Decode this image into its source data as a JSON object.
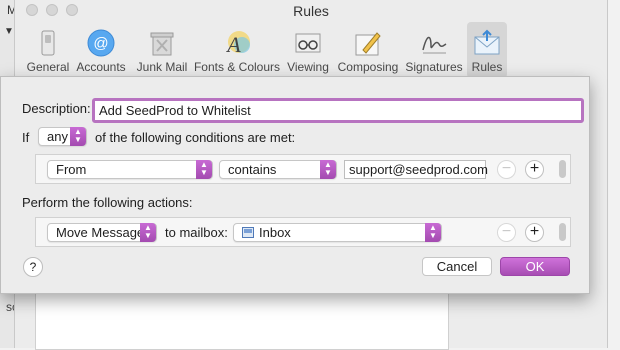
{
  "background": {
    "left_initial": "M",
    "left_bottom_text": "sc"
  },
  "window": {
    "title": "Rules"
  },
  "toolbar": {
    "items": [
      {
        "label": "General",
        "icon": "switch-icon"
      },
      {
        "label": "Accounts",
        "icon": "at-icon"
      },
      {
        "label": "Junk Mail",
        "icon": "trash-icon"
      },
      {
        "label": "Fonts & Colours",
        "icon": "font-icon"
      },
      {
        "label": "Viewing",
        "icon": "glasses-icon"
      },
      {
        "label": "Composing",
        "icon": "pencil-icon"
      },
      {
        "label": "Signatures",
        "icon": "signature-icon"
      },
      {
        "label": "Rules",
        "icon": "rules-icon",
        "active": true
      }
    ]
  },
  "rule": {
    "description_label": "Description:",
    "description_value": "Add SeedProd to Whitelist",
    "if_label": "If",
    "match_value": "any",
    "conditions_suffix": "of the following conditions are met:",
    "condition": {
      "field": "From",
      "operator": "contains",
      "value": "support@seedprod.com"
    },
    "actions_label": "Perform the following actions:",
    "action": {
      "type": "Move Message",
      "to_label": "to mailbox:",
      "mailbox": "Inbox"
    },
    "help_label": "?",
    "cancel_label": "Cancel",
    "ok_label": "OK",
    "remove_symbol": "−",
    "add_symbol": "+"
  },
  "colors": {
    "accent": "#b06abd",
    "focus_ring": "#b773c0"
  }
}
